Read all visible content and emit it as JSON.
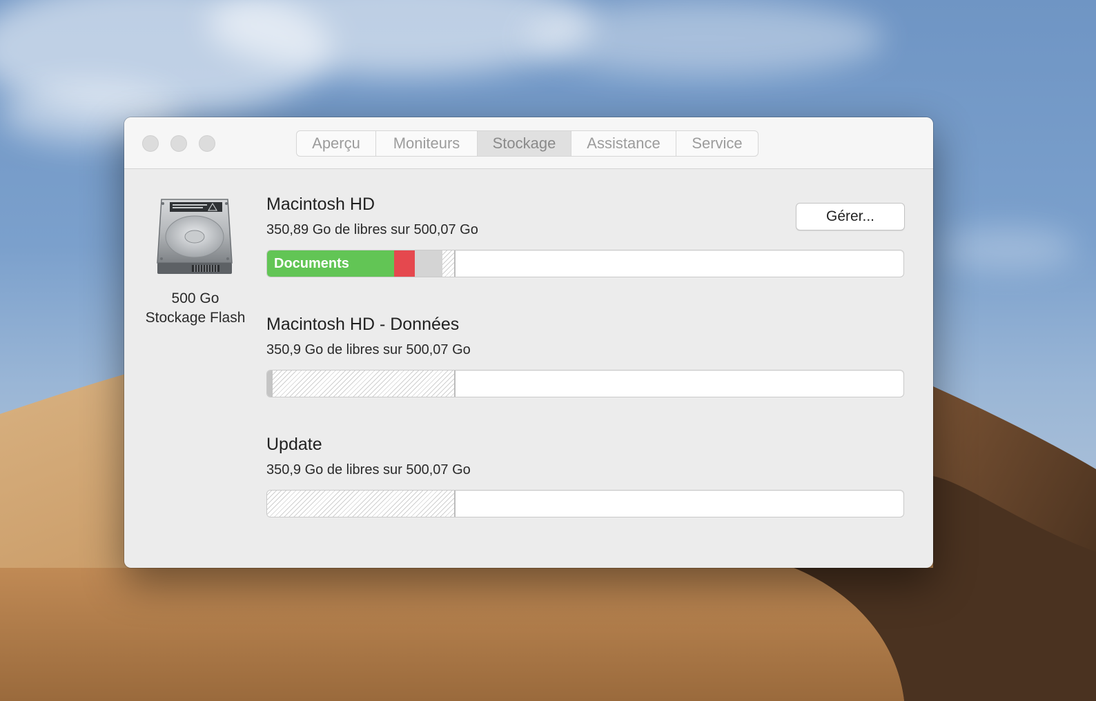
{
  "tabs": [
    "Aperçu",
    "Moniteurs",
    "Stockage",
    "Assistance",
    "Service"
  ],
  "active_tab": "Stockage",
  "disk": {
    "capacity": "500 Go",
    "type": "Stockage Flash"
  },
  "manage_button": "Gérer...",
  "volumes": [
    {
      "name": "Macintosh HD",
      "info": "350,89 Go de libres sur 500,07 Go",
      "category_label": "Documents"
    },
    {
      "name": "Macintosh HD - Données",
      "info": "350,9 Go de libres sur 500,07 Go"
    },
    {
      "name": "Update",
      "info": "350,9 Go de libres sur 500,07 Go"
    }
  ],
  "colors": {
    "documents": "#62c555",
    "apps": "#e5484e",
    "other": "#d4d4d4"
  }
}
